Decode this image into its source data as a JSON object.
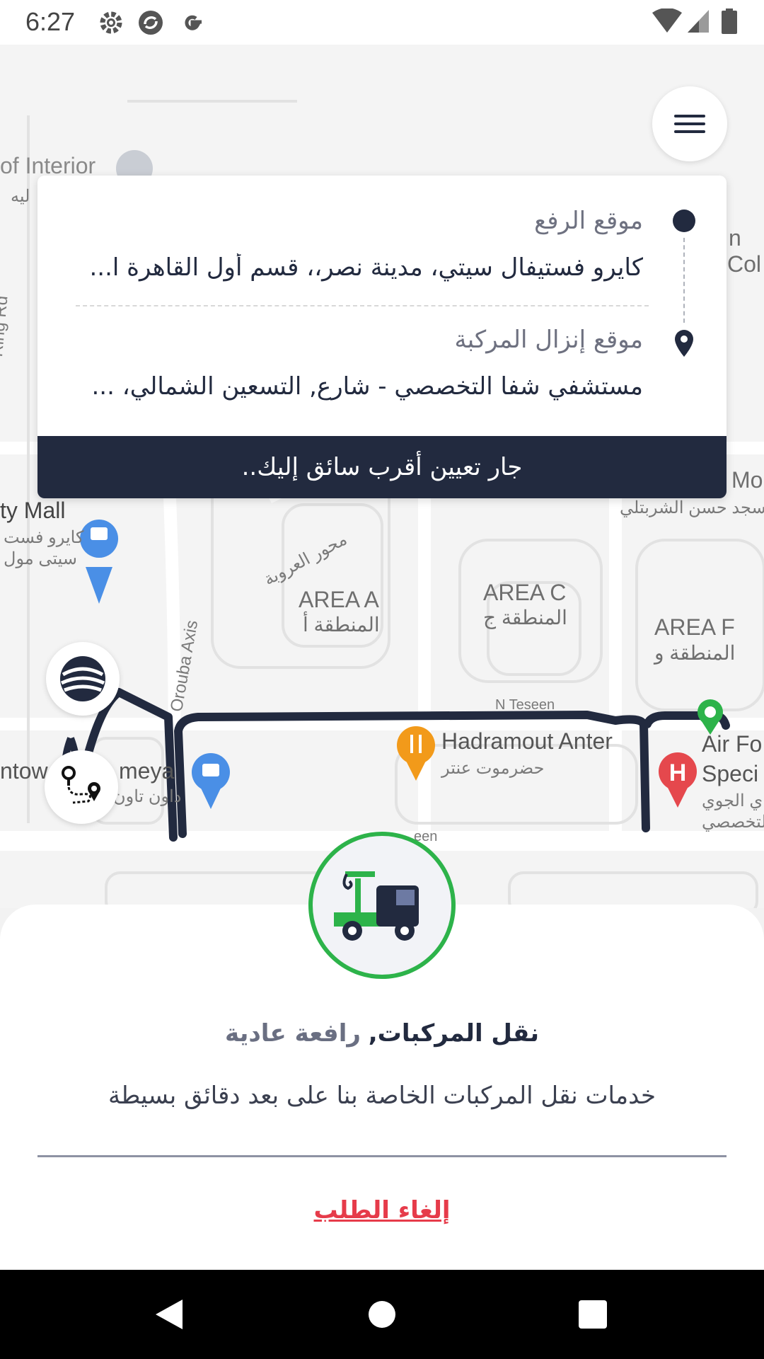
{
  "status_bar": {
    "time": "6:27",
    "left_icons": [
      "gear-icon",
      "sync-icon",
      "google-icon"
    ],
    "right_icons": [
      "wifi-icon",
      "signal-icon",
      "battery-icon"
    ]
  },
  "map": {
    "labels": [
      "of Interior",
      "ليه",
      "Ring Rd",
      "ty Mall",
      "كايرو فست",
      "سيتى مول",
      "محور العروبة",
      "AREA A",
      "المنطقة أ",
      "AREA C",
      "المنطقة ج",
      "AREA F",
      "المنطقة و",
      "Orouba Axis",
      "N Teseen",
      "Hadramout Anter",
      "حضرموت عنتر",
      "ntow",
      "meya",
      "داون تاون",
      "Air Fo",
      "Speci",
      "ي الجوي",
      "لتخصصي",
      "n",
      "Col",
      "Mo",
      "سجد حسن الشربتلي",
      "een"
    ]
  },
  "menu_button": {
    "icon": "hamburger-menu-icon"
  },
  "route_card": {
    "pickup": {
      "label": "موقع الرفع",
      "value": "كايرو فستيفال سيتي، مدينة نصر،، قسم أول القاهرة ا..."
    },
    "dropoff": {
      "label": "موقع إنزال المركبة",
      "value": "مستشفي شفا التخصصي - شارع, التسعين الشمالي، ..."
    },
    "status_banner": "جار تعيين أقرب سائق إليك.."
  },
  "fabs": {
    "top_icon": "globe-logo-icon",
    "bottom_icon": "route-icon"
  },
  "sheet": {
    "truck_icon": "tow-truck-icon",
    "service_type": "نقل المركبات,",
    "service_subtype": "رافعة عادية",
    "description": "خدمات نقل المركبات الخاصة بنا على بعد دقائق بسيطة",
    "cancel_label": "إلغاء الطلب"
  },
  "colors": {
    "primary": "#222a3f",
    "accent_green": "#2db34a",
    "cancel_red": "#e63b4a"
  },
  "nav_bar": {
    "buttons": [
      "back-icon",
      "home-icon",
      "recents-icon"
    ]
  }
}
